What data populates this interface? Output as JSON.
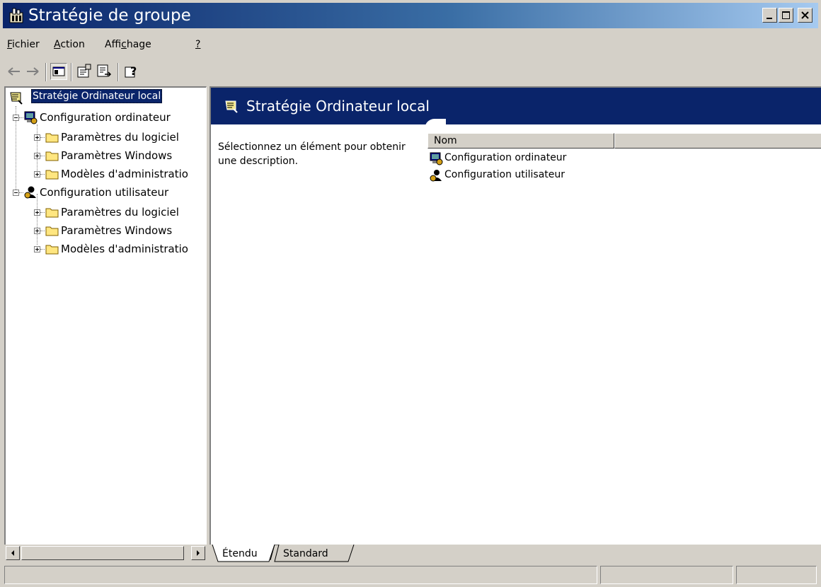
{
  "window": {
    "title": "Stratégie de groupe",
    "title_gradient": [
      "#0a246a",
      "#a6caf0"
    ]
  },
  "menu": {
    "items": [
      {
        "pre": "",
        "u": "F",
        "post": "ichier"
      },
      {
        "pre": "",
        "u": "A",
        "post": "ction"
      },
      {
        "pre": "Affi",
        "u": "c",
        "post": "hage"
      },
      {
        "pre": "",
        "u": "?",
        "post": ""
      }
    ]
  },
  "tree": {
    "root": "Stratégie Ordinateur local",
    "computer_config": "Configuration ordinateur",
    "computer_children": [
      "Paramètres du logiciel",
      "Paramètres Windows",
      "Modèles d'administratio"
    ],
    "user_config": "Configuration utilisateur",
    "user_children": [
      "Paramètres du logiciel",
      "Paramètres Windows",
      "Modèles d'administratio"
    ]
  },
  "details": {
    "title": "Stratégie Ordinateur local",
    "description": "Sélectionnez un élément pour obtenir une description.",
    "column_name": "Nom",
    "items": [
      "Configuration ordinateur",
      "Configuration utilisateur"
    ],
    "header_color": "#0a246a"
  },
  "tabs": [
    "Étendu",
    "Standard"
  ],
  "icons": {
    "app": "group-policy-icon",
    "back": "back-arrow-icon",
    "forward": "forward-arrow-icon",
    "tree": "show-hide-tree-icon",
    "properties": "properties-icon",
    "export": "export-list-icon",
    "help": "help-icon"
  }
}
